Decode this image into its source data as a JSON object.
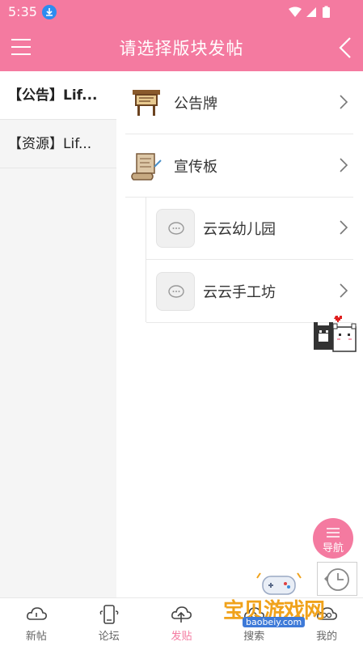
{
  "status_bar": {
    "time": "5:35"
  },
  "header": {
    "title": "请选择版块发帖"
  },
  "left_categories": [
    {
      "label": "【公告】Lif...",
      "active": true
    },
    {
      "label": "【资源】Lif...",
      "active": false
    }
  ],
  "boards": [
    {
      "label": "公告牌",
      "icon": "bulletin-board-icon"
    },
    {
      "label": "宣传板",
      "icon": "scroll-icon"
    }
  ],
  "sub_boards": [
    {
      "label": "云云幼儿园",
      "icon": "chat-bubble-icon"
    },
    {
      "label": "云云手工坊",
      "icon": "chat-bubble-icon"
    }
  ],
  "fab": {
    "label": "导航"
  },
  "tabs": [
    {
      "label": "新帖",
      "icon": "cloud-icon"
    },
    {
      "label": "论坛",
      "icon": "phone-cloud-icon"
    },
    {
      "label": "发贴",
      "icon": "cloud-upload-icon",
      "active": true
    },
    {
      "label": "搜索",
      "icon": "cloud-search-icon"
    },
    {
      "label": "我的",
      "icon": "cloud-user-icon"
    }
  ],
  "watermark": {
    "text": "宝贝游戏网",
    "url": "baobeiy.com"
  },
  "colors": {
    "accent": "#f47aa0"
  }
}
